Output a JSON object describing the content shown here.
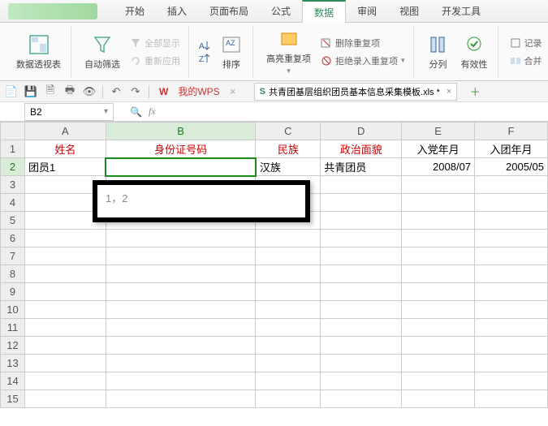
{
  "tabs": {
    "t0": "开始",
    "t1": "插入",
    "t2": "页面布局",
    "t3": "公式",
    "t4": "数据",
    "t5": "审阅",
    "t6": "视图",
    "t7": "开发工具"
  },
  "ribbon": {
    "pivot": "数据透视表",
    "autofilter": "自动筛选",
    "showall": "全部显示",
    "reapply": "重新应用",
    "sort": "排序",
    "highlight_dup": "高亮重复项",
    "remove_dup": "删除重复项",
    "reject_dup": "拒绝录入重复项",
    "text_to_col": "分列",
    "validation": "有效性",
    "consolidate": "合并",
    "record": "记录"
  },
  "quick": {
    "wps": "我的WPS",
    "filename": "共青团基层组织团员基本信息采集模板.xls *"
  },
  "formula": {
    "namebox": "B2",
    "fx": "fx"
  },
  "cols": {
    "A": "A",
    "B": "B",
    "C": "C",
    "D": "D",
    "E": "E",
    "F": "F"
  },
  "headers": {
    "A": "姓名",
    "B": "身份证号码",
    "C": "民族",
    "D": "政治面貌",
    "E": "入党年月",
    "F": "入团年月"
  },
  "row2": {
    "A": "团员1",
    "B": "",
    "C": "汉族",
    "D": "共青团员",
    "E": "2008/07",
    "F": "2005/05"
  },
  "tooltip": "1，2"
}
